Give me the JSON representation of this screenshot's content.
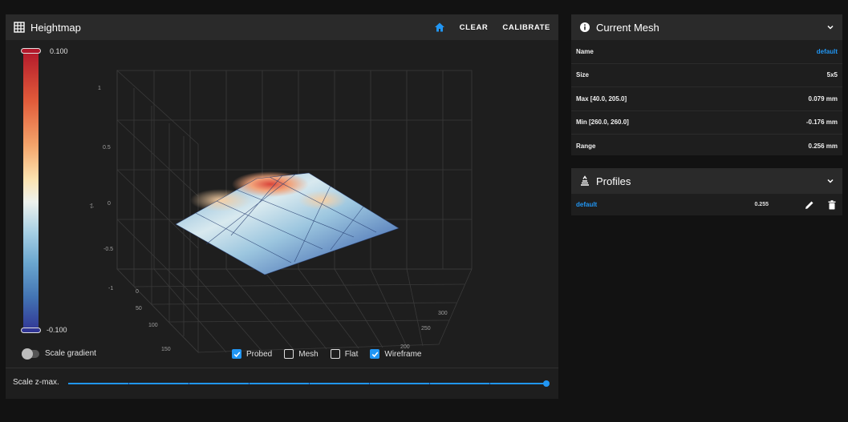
{
  "heightmap": {
    "title": "Heightmap",
    "home_icon": "home-icon",
    "clear_label": "CLEAR",
    "calibrate_label": "CALIBRATE",
    "gradient": {
      "max_label": "0.100",
      "min_label": "-0.100",
      "top_color": "#b2182b",
      "bottom_color": "#313695"
    },
    "z_axis": {
      "label": "Z",
      "ticks": [
        "1",
        "0.5",
        "0",
        "-0.5",
        "-1"
      ]
    },
    "y_axis": {
      "ticks": [
        "0",
        "50",
        "100",
        "150"
      ]
    },
    "x_axis": {
      "ticks": [
        "200",
        "250",
        "300"
      ]
    },
    "scale_gradient_label": "Scale gradient",
    "scale_gradient_on": false,
    "checkboxes": [
      {
        "label": "Probed",
        "checked": true
      },
      {
        "label": "Mesh",
        "checked": false
      },
      {
        "label": "Flat",
        "checked": false
      },
      {
        "label": "Wireframe",
        "checked": true
      }
    ],
    "scale_zmax_label": "Scale z-max.",
    "scale_zmax_value": 1.0
  },
  "mesh": {
    "title": "Current Mesh",
    "rows": [
      {
        "key": "Name",
        "value": "default",
        "link": true
      },
      {
        "key": "Size",
        "value": "5x5",
        "link": false
      },
      {
        "key": "Max [40.0, 205.0]",
        "value": "0.079 mm",
        "link": false
      },
      {
        "key": "Min [260.0, 260.0]",
        "value": "-0.176 mm",
        "link": false
      },
      {
        "key": "Range",
        "value": "0.256 mm",
        "link": false
      }
    ]
  },
  "profiles": {
    "title": "Profiles",
    "items": [
      {
        "name": "default",
        "range": "0.255"
      }
    ]
  },
  "colors": {
    "accent": "#2196f3",
    "card": "#1e1e1e",
    "header": "#2a2a2a",
    "background": "#121212"
  }
}
